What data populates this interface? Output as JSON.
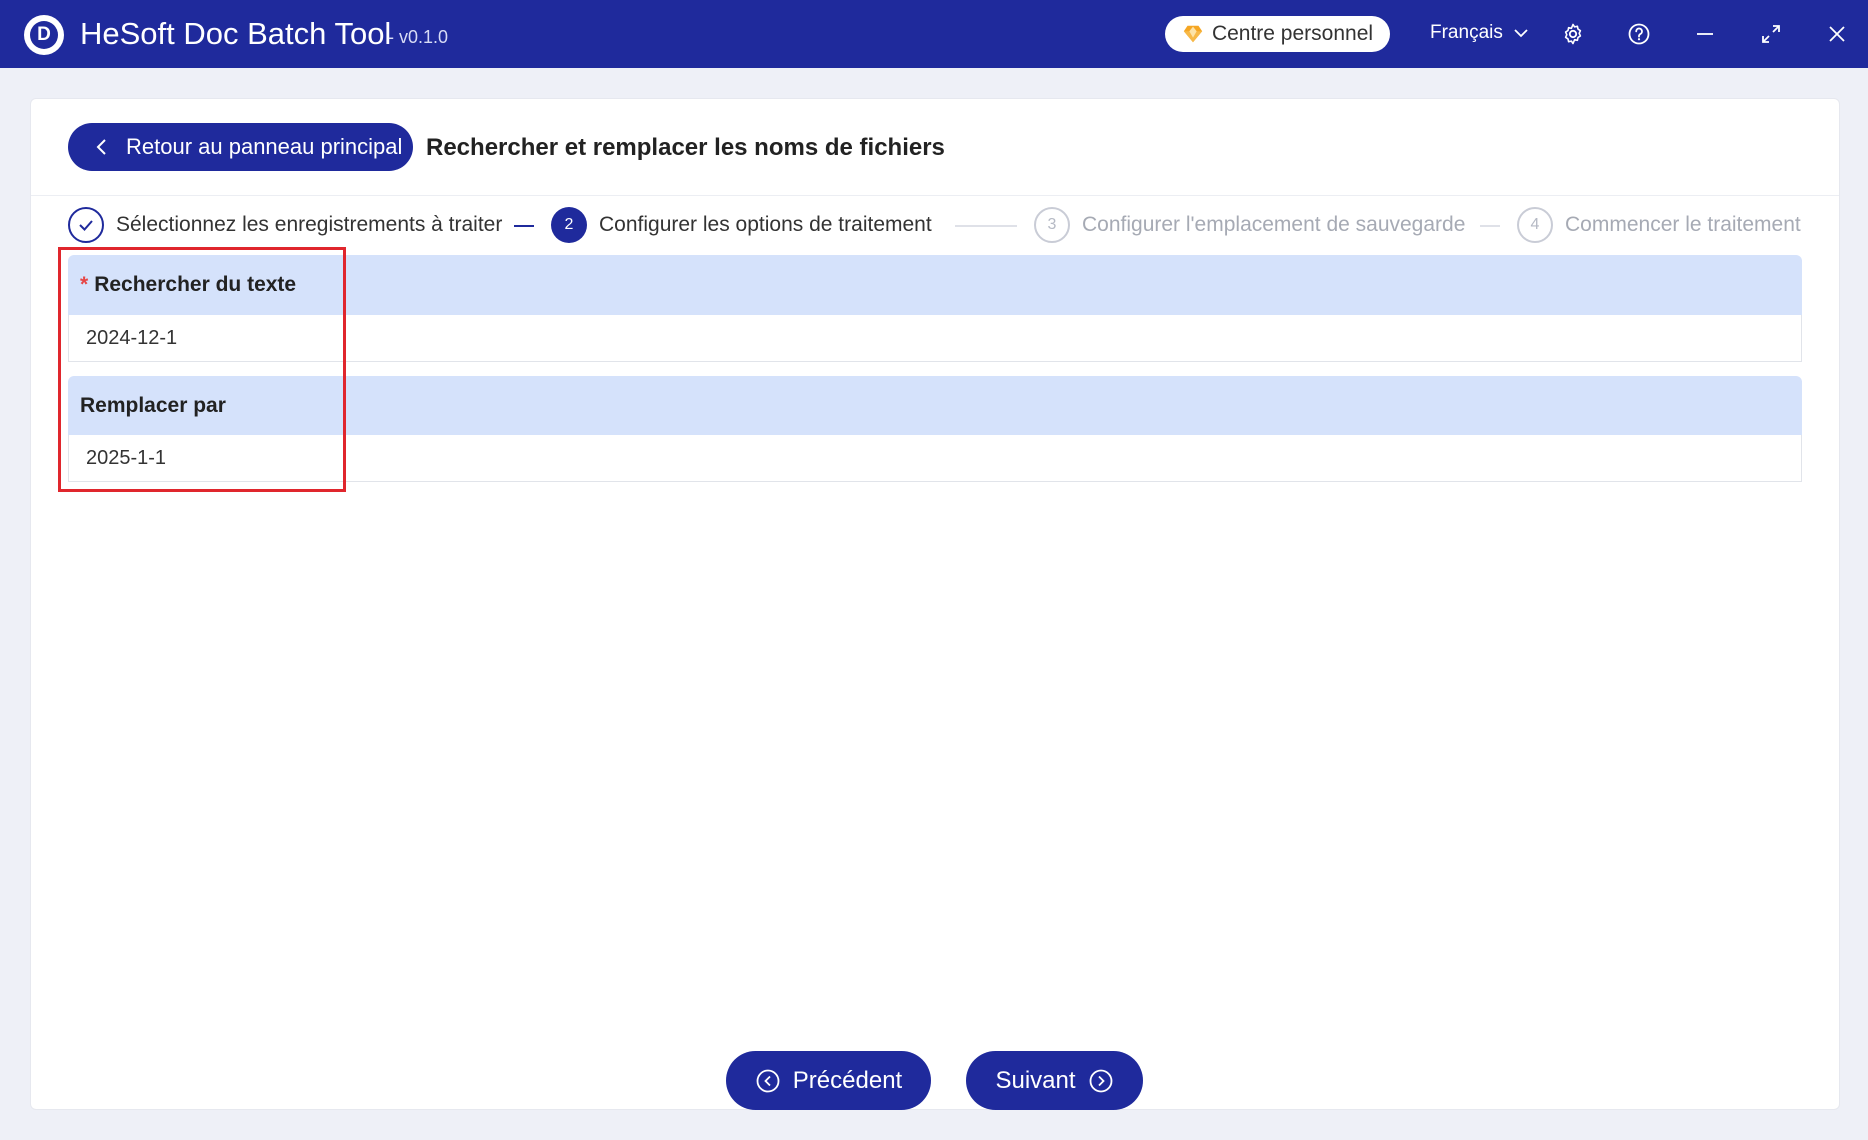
{
  "titlebar": {
    "app_title": "HeSoft Doc Batch Tool",
    "version": "- v0.1.0",
    "logo_letter": "D",
    "centre_label": "Centre personnel",
    "language": "Français",
    "icons": [
      "gear-icon",
      "help-icon",
      "minimize-icon",
      "maximize-icon",
      "close-icon"
    ],
    "accent": "#1f2a9c"
  },
  "header": {
    "back_label": "Retour au panneau principal",
    "page_title": "Rechercher et remplacer les noms de fichiers"
  },
  "steps": [
    {
      "number": "✓",
      "label": "Sélectionnez les enregistrements à traiter",
      "state": "done"
    },
    {
      "number": "2",
      "label": "Configurer les options de traitement",
      "state": "active"
    },
    {
      "number": "3",
      "label": "Configurer l'emplacement de sauvegarde",
      "state": "pending"
    },
    {
      "number": "4",
      "label": "Commencer le traitement",
      "state": "pending"
    }
  ],
  "form": {
    "search": {
      "required_mark": "*",
      "label": "Rechercher du texte",
      "value": "2024-12-1"
    },
    "replace": {
      "label": "Remplacer par",
      "value": "2025-1-1"
    }
  },
  "footer": {
    "prev_label": "Précédent",
    "next_label": "Suivant"
  },
  "colors": {
    "primary": "#1f2a9c",
    "field_header_bg": "#d5e2fb",
    "highlight": "#e0262d",
    "required": "#e64545"
  }
}
